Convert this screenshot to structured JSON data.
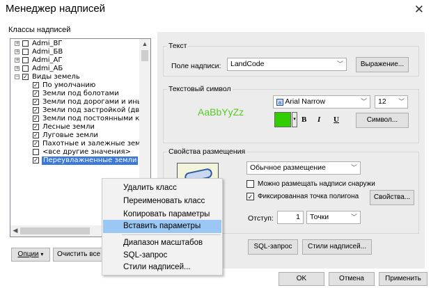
{
  "window": {
    "title": "Менеджер надписей"
  },
  "classes": {
    "caption": "Классы надписей",
    "items": [
      {
        "label": "Admi_ВГ",
        "checked": false
      },
      {
        "label": "Admi_БВ",
        "checked": false
      },
      {
        "label": "Admi_АГ",
        "checked": false
      },
      {
        "label": "Admi_АБ",
        "checked": false
      },
      {
        "label": "Виды земель",
        "checked": true
      },
      {
        "label": "По умолчанию",
        "checked": true
      },
      {
        "label": "Земли под болотами",
        "checked": true
      },
      {
        "label": "Земли под дорогами и иными т",
        "checked": true
      },
      {
        "label": "Земли под застройкой (дворы)",
        "checked": true
      },
      {
        "label": "Земли под постоянными культу",
        "checked": true
      },
      {
        "label": "Лесные земли",
        "checked": true
      },
      {
        "label": "Луговые земли",
        "checked": true
      },
      {
        "label": "Пахотные и залежные земли",
        "checked": true
      },
      {
        "label": "<все другие значения>",
        "checked": false
      },
      {
        "label": "Переувлажненные земли",
        "checked": true
      }
    ]
  },
  "bottom_left": {
    "options": "Опции",
    "clear_all": "Очистить все"
  },
  "text_group": {
    "caption": "Текст",
    "field_label": "Поле надписи:",
    "field_value": "LandCode",
    "expression": "Выражение..."
  },
  "symbol_group": {
    "caption": "Текстовый символ",
    "preview": "AaBbYyZz",
    "font": "Arial Narrow",
    "size": "12",
    "bold": "B",
    "italic": "I",
    "underline": "U",
    "symbol_btn": "Символ...",
    "color": "#33cc00"
  },
  "placement_group": {
    "caption": "Свойства размещения",
    "mode": "Обычное размещение",
    "outside": "Можно размещать надписи снаружи",
    "outside_checked": false,
    "fixed": "Фиксированная точка полигона",
    "fixed_checked": true,
    "properties": "Свойства...",
    "offset_label": "Отступ:",
    "offset_value": "1",
    "units": "Точки",
    "sql": "SQL-запрос",
    "styles": "Стили надписей..."
  },
  "context_menu": [
    {
      "label": "Удалить класс",
      "highlight": false
    },
    {
      "label": "Переименовать класс",
      "highlight": false
    },
    {
      "label": "Копировать параметры",
      "highlight": false
    },
    {
      "label": "Вставить параметры",
      "highlight": true
    },
    {
      "label": "Диапазон масштабов",
      "highlight": false
    },
    {
      "label": "SQL-запрос",
      "highlight": false
    },
    {
      "label": "Стили надписей...",
      "highlight": false
    }
  ],
  "footer": {
    "ok": "OK",
    "cancel": "Отмена",
    "apply": "Применить"
  }
}
